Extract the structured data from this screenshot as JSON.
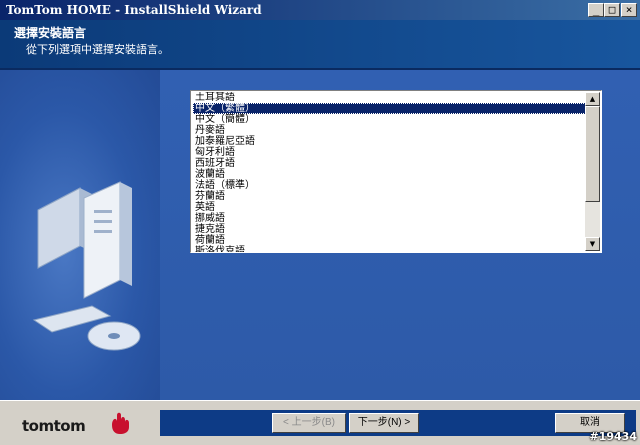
{
  "window": {
    "title": "TomTom HOME - InstallShield Wizard"
  },
  "titlebar": {
    "minimize": "_",
    "maximize": "□",
    "close": "×"
  },
  "header": {
    "title": "選擇安裝語言",
    "subtitle": "從下列選項中選擇安裝語言。"
  },
  "language_list": {
    "items": [
      "土耳其語",
      "中文（繁體）",
      "中文（簡體）",
      "丹麥語",
      "加泰羅尼亞語",
      "匈牙利語",
      "西班牙語",
      "波蘭語",
      "法語（標準）",
      "芬蘭語",
      "英語",
      "挪威語",
      "捷克語",
      "荷蘭語",
      "斯洛伐克語"
    ],
    "selected": "中文（繁體）"
  },
  "scroll": {
    "up": "▲",
    "down": "▼"
  },
  "footer": {
    "brand": "tomtom",
    "back_label": "< 上一步(B)",
    "next_label": "下一步(N) >",
    "cancel_label": "取消"
  },
  "watermark": "#19434",
  "colors": {
    "accent": "#0a246a",
    "panel": "#2f5fb0",
    "chrome": "#d4d0c8",
    "logo_hand": "#c8102e"
  }
}
